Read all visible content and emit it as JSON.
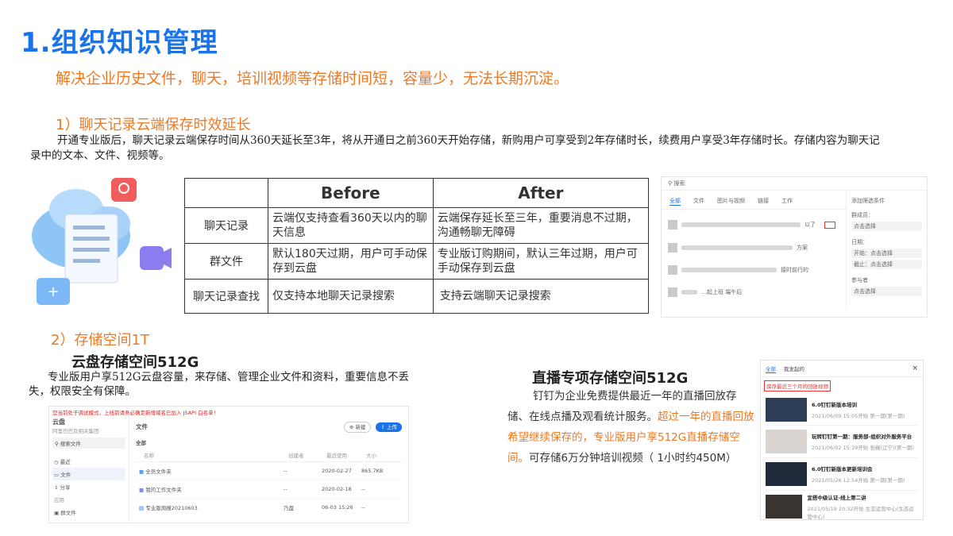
{
  "title": "1.组织知识管理",
  "subtitle": "解决企业历史文件，聊天，培训视频等存储时间短，容量少，无法长期沉淀。",
  "section1": {
    "heading": "1）聊天记录云端保存时效延长",
    "paragraph": "开通专业版后，聊天记录云端保存时间从360天延长至3年，将从开通日之前360天开始存储，新购用户可享受到2年存储时长，续费用户享受3年存储时长。存储内容为聊天记录中的文本、文件、视频等。"
  },
  "table": {
    "col_before": "Before",
    "col_after": "After",
    "rows": [
      {
        "label": "聊天记录",
        "before": "云端仅支持查看360天以内的聊天信息",
        "after": "云端保存延长至三年，重要消息不过期，沟通畅聊无障碍"
      },
      {
        "label": "群文件",
        "before": "默认180天过期，用户可手动保存到云盘",
        "after": "专业版订购期间，默认三年过期，用户可手动保存到云盘"
      },
      {
        "label": "聊天记录查找",
        "before": "仅支持本地聊天记录搜索",
        "after": "支持云端聊天记录搜索"
      }
    ]
  },
  "chat_shot": {
    "search_placeholder": "搜索",
    "tabs": [
      "全部",
      "文件",
      "图片与视频",
      "链接",
      "工作"
    ],
    "filter_title": "添加筛选条件",
    "filter_groups": [
      {
        "label": "群成员：",
        "value": "点击选择"
      },
      {
        "label": "日期：",
        "value": "开始：点击选择"
      },
      {
        "label": "",
        "value": "截止：点击选择"
      },
      {
        "label": "参与者",
        "value": "点击选择"
      }
    ],
    "rows": [
      {
        "snippet": "以了"
      },
      {
        "snippet": "方案"
      },
      {
        "snippet": "接时前行的"
      },
      {
        "snippet": "…起上班 端午后"
      }
    ]
  },
  "section2": {
    "heading": "2）存储空间1T",
    "cloud_heading": "云盘存储空间512G",
    "cloud_paragraph": "专业版用户享512G云盘容量，来存储、管理企业文件和资料，重要信息不丢失，权限安全有保障。",
    "live_heading": "直播专项存储空间512G",
    "live_paragraph_1": "钉钉为企业免费提供最近一年的直播回放存储、在线点播及观看统计服务。",
    "live_paragraph_hl": "超过一年的直播回放希望继续保存的，专业版用户享512G直播存储空间。",
    "live_paragraph_2": "可存储6万分钟培训视频（ 1小时约450M）"
  },
  "drive_shot": {
    "warning": "您当前处于调试模式，上线前请务必确定新增域名已加入 JSAPI 白名单！",
    "app_name": "云盘",
    "org_hint": "阿里巴巴及相关集团",
    "search_placeholder": "搜索文件",
    "nav": [
      "最近",
      "文件",
      "分享",
      "应用",
      "群文件"
    ],
    "header_title": "文件",
    "btn_new": "新建",
    "btn_upload": "上传",
    "filter_all": "全部",
    "columns": [
      "名称",
      "创建者",
      "最近使用",
      "大小"
    ],
    "rows": [
      {
        "name": "全员文件夹",
        "creator": "--",
        "date": "2020-02-27",
        "size": "865.7KB"
      },
      {
        "name": "我的工作文件夹",
        "creator": "--",
        "date": "2020-02-18",
        "size": "--"
      },
      {
        "name": "专业版周报20210603",
        "creator": "乃盘",
        "date": "06-03 15:26",
        "size": "--"
      }
    ]
  },
  "live_shot": {
    "tabs": [
      "全部",
      "我发起的"
    ],
    "close": "×",
    "notice": "保存最近三个月的回放视频",
    "items": [
      {
        "title": "6.0钉钉新版本培训",
        "meta": "2021/06/09 15:05开始 第一期(第一期)"
      },
      {
        "title": "玩转钉钉第一期：服务部-组织对外服务平台",
        "meta": "2021/06/02 15:39开始 张巍(辽宁)(第一期)"
      },
      {
        "title": "6.0钉钉新版本更新培训会",
        "meta": "2021/05/26 12:54开始 第一期(第一期)"
      },
      {
        "title": "宜搭中级认证-线上第二讲",
        "meta": "2021/05/19 20:32开始 生态运营中心(生态运营中心)"
      }
    ]
  },
  "colors": {
    "accent_blue": "#1a73e8",
    "accent_orange": "#f07820"
  }
}
